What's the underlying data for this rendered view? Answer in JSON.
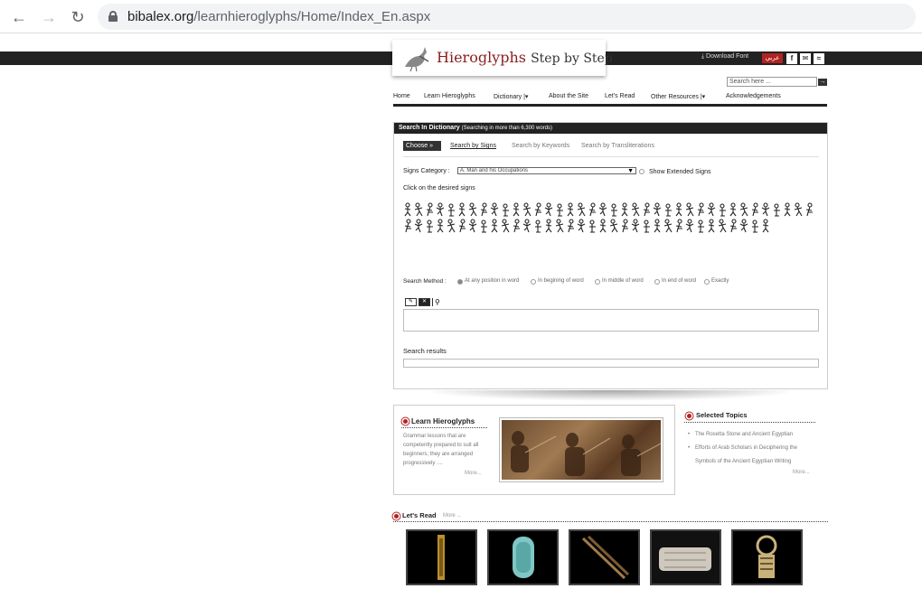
{
  "browser": {
    "url_host": "bibalex.org",
    "url_path": "/learnhieroglyphs/Home/Index_En.aspx"
  },
  "header": {
    "logo_title": "Hieroglyphs",
    "logo_subtitle": "Step by Step",
    "download_font": "Download Font",
    "arabic_label": "عربي",
    "search_placeholder": "Search here ..."
  },
  "menu": {
    "items": [
      "Home",
      "Learn Hieroglyphs",
      "Dictionary |▾",
      "About the Site",
      "Let's Read",
      "Other Resources |▾",
      "Acknowledgements"
    ]
  },
  "dictionary": {
    "title": "Search In Dictionary",
    "title_note": "(Searching in more than 6,300 words)",
    "choose": "Choose",
    "tabs": [
      "Search by Signs",
      "Search by Keywords",
      "Search by Transliterations"
    ],
    "signs_category_label": "Signs Category :",
    "signs_category_value": "A. Man and his Occupations",
    "show_extended": "Show Extended Signs",
    "click_hint": "Click on the desired signs",
    "search_method_label": "Search Method :",
    "methods": [
      "At any position in word",
      "In begining of word",
      "In middle of word",
      "In end of word",
      "Exactly"
    ],
    "search_results": "Search results"
  },
  "learn": {
    "title": "Learn Hieroglyphs",
    "text": "Grammar lessons that are competently prepared to suit all beginners; they are arranged progressively ....",
    "more": "More..."
  },
  "topics": {
    "title": "Selected Topics",
    "items": [
      "The Rosetta Stone and Ancient Egyptian",
      "Efforts of Arab Scholars in Deciphering the",
      "Symbols of the Ancient Egyptian Writing"
    ],
    "more": "More..."
  },
  "lets_read": {
    "title": "Let's Read",
    "more": "More ..."
  }
}
